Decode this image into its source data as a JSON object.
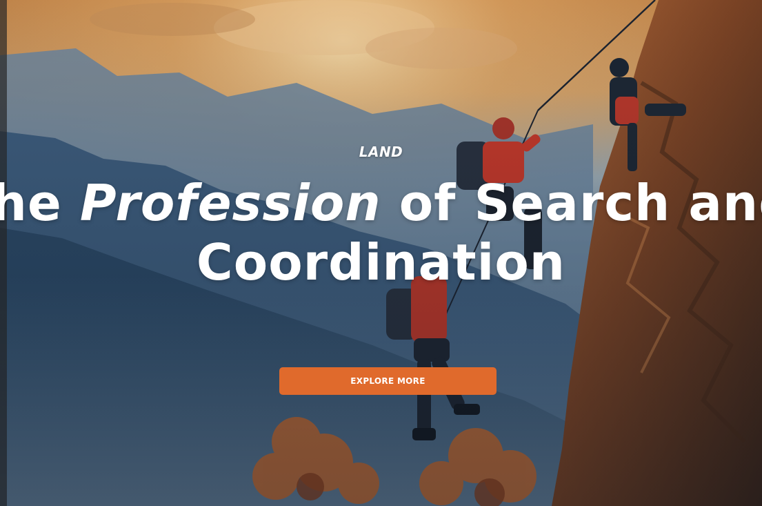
{
  "hero": {
    "eyebrow": "LAND",
    "headline": {
      "line1_prefix": "the ",
      "line1_emphasis": "Profession",
      "line1_suffix": " of Search and",
      "line2": "Coordination"
    },
    "cta_label": "EXPLORE MORE"
  },
  "background": {
    "description_icon": "climbers-on-cliff-photo"
  },
  "colors": {
    "cta_background": "#e06a2c",
    "text": "#ffffff"
  }
}
